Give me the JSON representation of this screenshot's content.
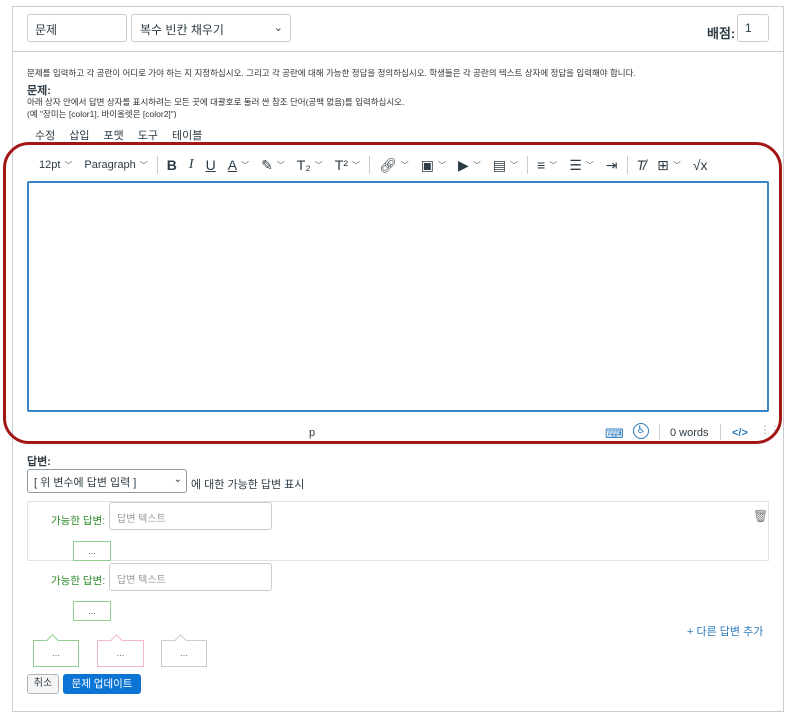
{
  "header": {
    "question_name": "문제",
    "question_type": "복수 빈칸 채우기",
    "points_label": "배점:",
    "points_value": "1"
  },
  "instructions": "문제를 입력하고 각 공란이 어디로 가야 하는 지 지정하십시오. 그리고 각 공란에 대해 가능한 정답을 정의하십시오. 학생들은 각 공란의 텍스트 상자에 정답을 입력해야 합니다.",
  "question_label": "문제:",
  "hint_line1": "아래 상자 안에서 답변 상자를 표시하려는 모든 곳에 대괄호로 둘러 싼 참조 단어(공백 없음)를 입력하십시오.",
  "hint_line2": "(예 \"장미는 [color1], 바이올렛은 [color2]\")",
  "menubar": [
    "수정",
    "삽입",
    "포맷",
    "도구",
    "테이블"
  ],
  "toolbar": {
    "font_size": "12pt",
    "block_format": "Paragraph"
  },
  "statusbar": {
    "path": "p",
    "word_count": "0 words",
    "html_toggle": "</>"
  },
  "answers": {
    "label": "답변:",
    "variable_select": "[ 위 변수에 답변 입력 ]",
    "variable_suffix": "에 대한 가능한 답변 표시",
    "possible_answer_label": "가능한 답변:",
    "answer_placeholder": "답변 텍스트",
    "dots": "...",
    "add_another": "+ 다른 답변 추가"
  },
  "buttons": {
    "cancel": "취소",
    "update": "문제 업데이트"
  },
  "colors": {
    "accent_blue": "#0b74d4",
    "highlight_red": "#a31616",
    "answer_green": "#2a8a2a"
  }
}
